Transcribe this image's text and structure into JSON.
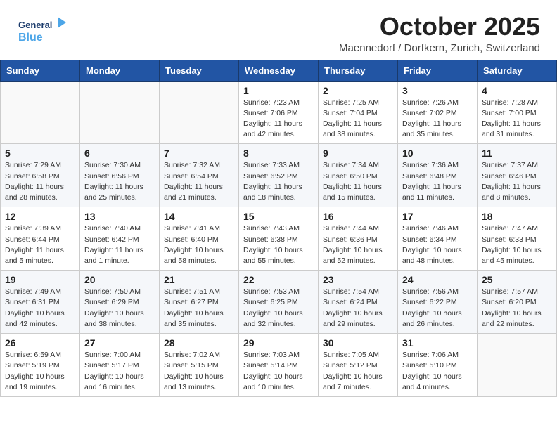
{
  "header": {
    "logo_line1": "General",
    "logo_line2": "Blue",
    "month": "October 2025",
    "location": "Maennedorf / Dorfkern, Zurich, Switzerland"
  },
  "weekdays": [
    "Sunday",
    "Monday",
    "Tuesday",
    "Wednesday",
    "Thursday",
    "Friday",
    "Saturday"
  ],
  "weeks": [
    {
      "days": [
        {
          "num": "",
          "info": ""
        },
        {
          "num": "",
          "info": ""
        },
        {
          "num": "",
          "info": ""
        },
        {
          "num": "1",
          "info": "Sunrise: 7:23 AM\nSunset: 7:06 PM\nDaylight: 11 hours\nand 42 minutes."
        },
        {
          "num": "2",
          "info": "Sunrise: 7:25 AM\nSunset: 7:04 PM\nDaylight: 11 hours\nand 38 minutes."
        },
        {
          "num": "3",
          "info": "Sunrise: 7:26 AM\nSunset: 7:02 PM\nDaylight: 11 hours\nand 35 minutes."
        },
        {
          "num": "4",
          "info": "Sunrise: 7:28 AM\nSunset: 7:00 PM\nDaylight: 11 hours\nand 31 minutes."
        }
      ]
    },
    {
      "days": [
        {
          "num": "5",
          "info": "Sunrise: 7:29 AM\nSunset: 6:58 PM\nDaylight: 11 hours\nand 28 minutes."
        },
        {
          "num": "6",
          "info": "Sunrise: 7:30 AM\nSunset: 6:56 PM\nDaylight: 11 hours\nand 25 minutes."
        },
        {
          "num": "7",
          "info": "Sunrise: 7:32 AM\nSunset: 6:54 PM\nDaylight: 11 hours\nand 21 minutes."
        },
        {
          "num": "8",
          "info": "Sunrise: 7:33 AM\nSunset: 6:52 PM\nDaylight: 11 hours\nand 18 minutes."
        },
        {
          "num": "9",
          "info": "Sunrise: 7:34 AM\nSunset: 6:50 PM\nDaylight: 11 hours\nand 15 minutes."
        },
        {
          "num": "10",
          "info": "Sunrise: 7:36 AM\nSunset: 6:48 PM\nDaylight: 11 hours\nand 11 minutes."
        },
        {
          "num": "11",
          "info": "Sunrise: 7:37 AM\nSunset: 6:46 PM\nDaylight: 11 hours\nand 8 minutes."
        }
      ]
    },
    {
      "days": [
        {
          "num": "12",
          "info": "Sunrise: 7:39 AM\nSunset: 6:44 PM\nDaylight: 11 hours\nand 5 minutes."
        },
        {
          "num": "13",
          "info": "Sunrise: 7:40 AM\nSunset: 6:42 PM\nDaylight: 11 hours\nand 1 minute."
        },
        {
          "num": "14",
          "info": "Sunrise: 7:41 AM\nSunset: 6:40 PM\nDaylight: 10 hours\nand 58 minutes."
        },
        {
          "num": "15",
          "info": "Sunrise: 7:43 AM\nSunset: 6:38 PM\nDaylight: 10 hours\nand 55 minutes."
        },
        {
          "num": "16",
          "info": "Sunrise: 7:44 AM\nSunset: 6:36 PM\nDaylight: 10 hours\nand 52 minutes."
        },
        {
          "num": "17",
          "info": "Sunrise: 7:46 AM\nSunset: 6:34 PM\nDaylight: 10 hours\nand 48 minutes."
        },
        {
          "num": "18",
          "info": "Sunrise: 7:47 AM\nSunset: 6:33 PM\nDaylight: 10 hours\nand 45 minutes."
        }
      ]
    },
    {
      "days": [
        {
          "num": "19",
          "info": "Sunrise: 7:49 AM\nSunset: 6:31 PM\nDaylight: 10 hours\nand 42 minutes."
        },
        {
          "num": "20",
          "info": "Sunrise: 7:50 AM\nSunset: 6:29 PM\nDaylight: 10 hours\nand 38 minutes."
        },
        {
          "num": "21",
          "info": "Sunrise: 7:51 AM\nSunset: 6:27 PM\nDaylight: 10 hours\nand 35 minutes."
        },
        {
          "num": "22",
          "info": "Sunrise: 7:53 AM\nSunset: 6:25 PM\nDaylight: 10 hours\nand 32 minutes."
        },
        {
          "num": "23",
          "info": "Sunrise: 7:54 AM\nSunset: 6:24 PM\nDaylight: 10 hours\nand 29 minutes."
        },
        {
          "num": "24",
          "info": "Sunrise: 7:56 AM\nSunset: 6:22 PM\nDaylight: 10 hours\nand 26 minutes."
        },
        {
          "num": "25",
          "info": "Sunrise: 7:57 AM\nSunset: 6:20 PM\nDaylight: 10 hours\nand 22 minutes."
        }
      ]
    },
    {
      "days": [
        {
          "num": "26",
          "info": "Sunrise: 6:59 AM\nSunset: 5:19 PM\nDaylight: 10 hours\nand 19 minutes."
        },
        {
          "num": "27",
          "info": "Sunrise: 7:00 AM\nSunset: 5:17 PM\nDaylight: 10 hours\nand 16 minutes."
        },
        {
          "num": "28",
          "info": "Sunrise: 7:02 AM\nSunset: 5:15 PM\nDaylight: 10 hours\nand 13 minutes."
        },
        {
          "num": "29",
          "info": "Sunrise: 7:03 AM\nSunset: 5:14 PM\nDaylight: 10 hours\nand 10 minutes."
        },
        {
          "num": "30",
          "info": "Sunrise: 7:05 AM\nSunset: 5:12 PM\nDaylight: 10 hours\nand 7 minutes."
        },
        {
          "num": "31",
          "info": "Sunrise: 7:06 AM\nSunset: 5:10 PM\nDaylight: 10 hours\nand 4 minutes."
        },
        {
          "num": "",
          "info": ""
        }
      ]
    }
  ]
}
